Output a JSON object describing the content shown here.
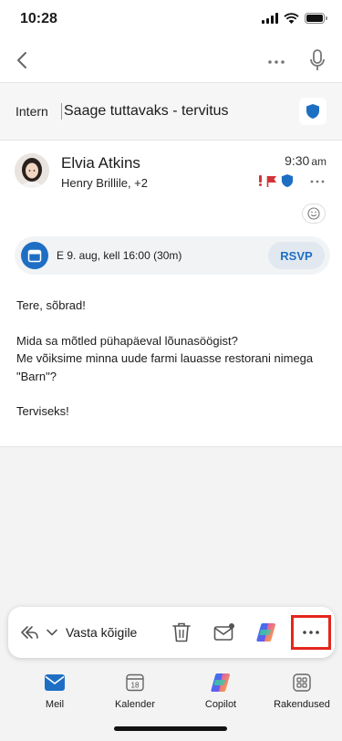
{
  "status_bar": {
    "time": "10:28"
  },
  "subject": {
    "tag": "Intern",
    "title": "Saage tuttavaks - tervitus"
  },
  "message": {
    "sender": "Elvia Atkins",
    "recipients": "Henry Brillile, +2",
    "time": "9:30",
    "time_suffix": "am",
    "event": {
      "text": "E 9. aug, kell 16:00 (30m)",
      "rsvp_label": "RSVP"
    },
    "body": {
      "greeting": "Tere, sõbrad!",
      "line1": "Mida sa mõtled pühapäeval lõunasöögist?",
      "line2": "Me võiksime minna uude farmi lauasse restorani nimega \"Barn\"?",
      "closing": "Terviseks!"
    }
  },
  "action_bar": {
    "reply_label": "Vasta kõigile"
  },
  "tabs": [
    {
      "label": "Meil"
    },
    {
      "label": "Kalender",
      "icon_text": "18"
    },
    {
      "label": "Copilot"
    },
    {
      "label": "Rakendused"
    }
  ],
  "colors": {
    "accent": "#1e6fc4",
    "highlight": "#e3261d",
    "flag": "#d13438"
  }
}
